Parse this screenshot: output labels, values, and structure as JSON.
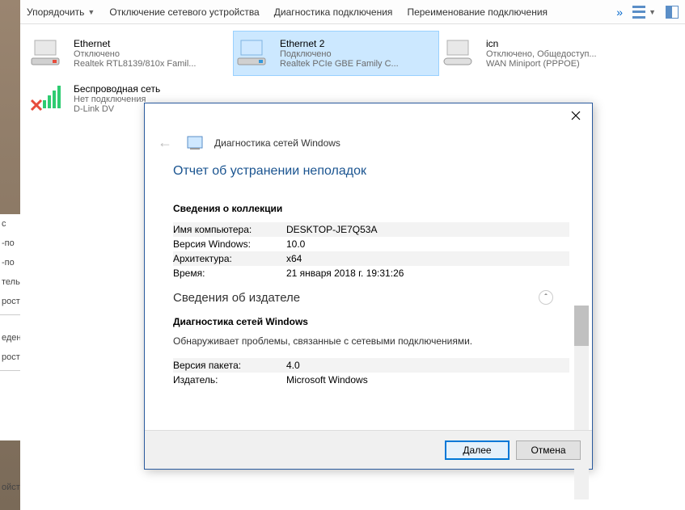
{
  "toolbar": {
    "organize": "Упорядочить",
    "disable": "Отключение сетевого устройства",
    "diagnose": "Диагностика подключения",
    "rename": "Переименование подключения",
    "more": "»"
  },
  "connections": [
    {
      "name": "Ethernet",
      "status": "Отключено",
      "device": "Realtek RTL8139/810x Famil..."
    },
    {
      "name": "Ethernet 2",
      "status": "Подключено",
      "device": "Realtek PCIe GBE Family C..."
    },
    {
      "name": "icn",
      "status": "Отключено, Общедоступ...",
      "device": "WAN Miniport (PPPOE)"
    },
    {
      "name": "Беспроводная сеть",
      "status": "Нет подключения",
      "device": "D-Link DV"
    }
  ],
  "dialog": {
    "title": "Диагностика сетей Windows",
    "report_title": "Отчет об устранении неполадок",
    "section_collection": "Сведения о коллекции",
    "rows": {
      "computer_name_k": "Имя компьютера:",
      "computer_name_v": "DESKTOP-JE7Q53A",
      "win_ver_k": "Версия Windows:",
      "win_ver_v": "10.0",
      "arch_k": "Архитектура:",
      "arch_v": "x64",
      "time_k": "Время:",
      "time_v": "21 января 2018 г. 19:31:26"
    },
    "section_publisher": "Сведения об издателе",
    "diag_title": "Диагностика сетей Windows",
    "diag_desc": "Обнаруживает проблемы, связанные с сетевыми подключениями.",
    "pkg_ver_k": "Версия пакета:",
    "pkg_ver_v": "4.0",
    "pub_k": "Издатель:",
    "pub_v": "Microsoft Windows",
    "next": "Далее",
    "cancel": "Отмена"
  },
  "left": {
    "i1": "с",
    "i2": "-по",
    "i3": "-по",
    "i4": "тель",
    "i5": "рост",
    "i6": "еден",
    "i7": "рость",
    "i8": "ойст"
  }
}
